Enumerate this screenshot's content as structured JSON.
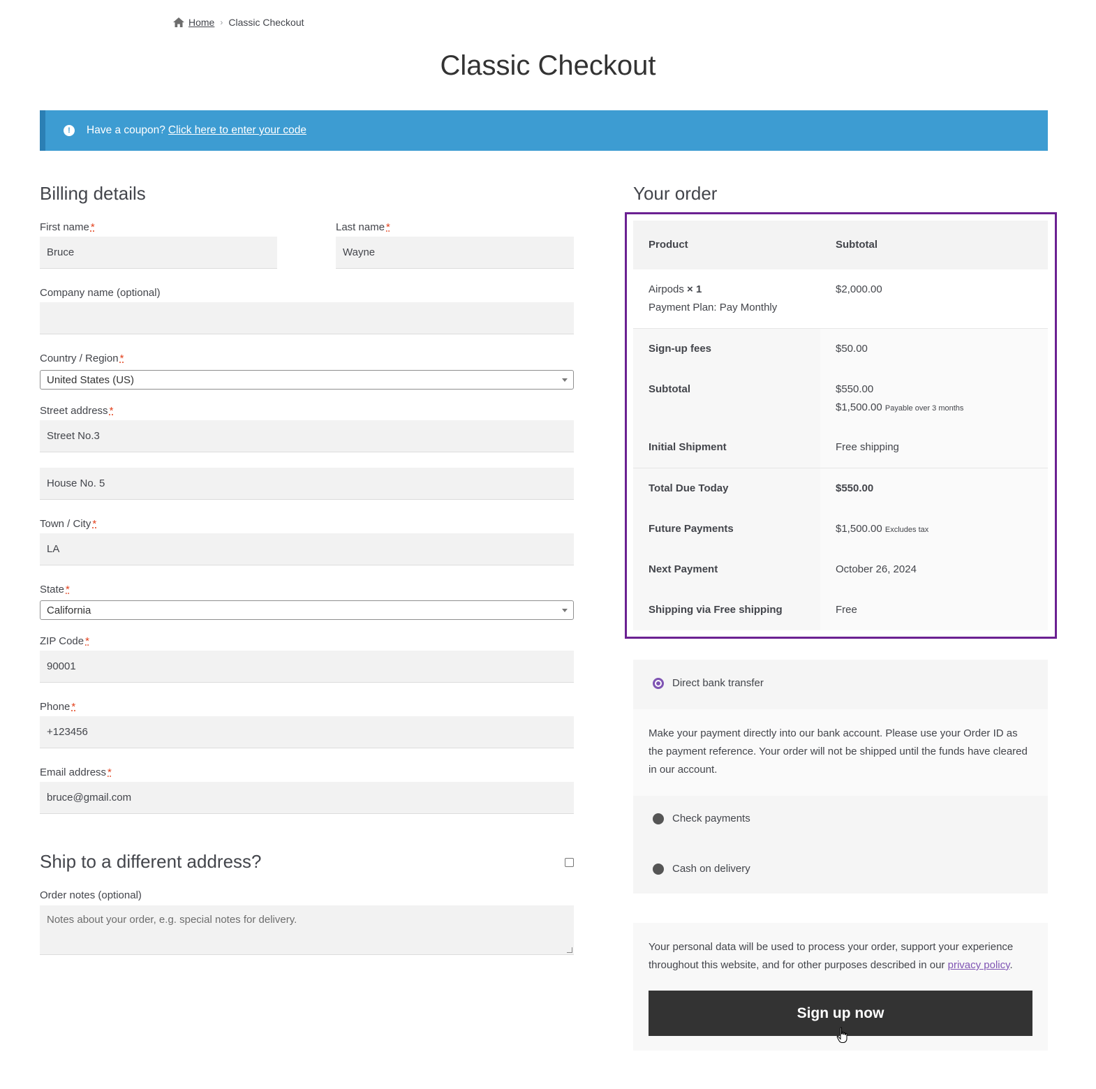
{
  "breadcrumb": {
    "home": "Home",
    "separator": "›",
    "current": "Classic Checkout"
  },
  "page_title": "Classic Checkout",
  "coupon": {
    "text": "Have a coupon?",
    "link": "Click here to enter your code",
    "icon": "info-icon"
  },
  "billing": {
    "heading": "Billing details",
    "required_mark": "*",
    "first_name": {
      "label": "First name",
      "value": "Bruce"
    },
    "last_name": {
      "label": "Last name",
      "value": "Wayne"
    },
    "company": {
      "label": "Company name (optional)",
      "value": ""
    },
    "country": {
      "label": "Country / Region",
      "value": "United States (US)"
    },
    "street": {
      "label": "Street address",
      "line1": "Street No.3",
      "line2": "House No. 5"
    },
    "city": {
      "label": "Town / City",
      "value": "LA"
    },
    "state": {
      "label": "State",
      "value": "California"
    },
    "zip": {
      "label": "ZIP Code",
      "value": "90001"
    },
    "phone": {
      "label": "Phone",
      "value": "+123456"
    },
    "email": {
      "label": "Email address",
      "value": "bruce@gmail.com"
    }
  },
  "ship_different": {
    "heading": "Ship to a different address?",
    "checked": false
  },
  "order_notes": {
    "label": "Order notes (optional)",
    "placeholder": "Notes about your order, e.g. special notes for delivery."
  },
  "order": {
    "heading": "Your order",
    "col_product": "Product",
    "col_subtotal": "Subtotal",
    "item_name": "Airpods",
    "item_qty": "× 1",
    "item_meta": "Payment Plan: Pay Monthly",
    "item_price": "$2,000.00",
    "signup_fees_label": "Sign-up fees",
    "signup_fees_value": "$50.00",
    "subtotal_label": "Subtotal",
    "subtotal_value1": "$550.00",
    "subtotal_value2": "$1,500.00",
    "subtotal_note": "Payable over 3 months",
    "initial_shipment_label": "Initial Shipment",
    "initial_shipment_value": "Free shipping",
    "total_due_label": "Total Due Today",
    "total_due_value": "$550.00",
    "future_label": "Future Payments",
    "future_value": "$1,500.00",
    "future_note": "Excludes tax",
    "next_label": "Next Payment",
    "next_value": "October 26, 2024",
    "shipping_label": "Shipping via Free shipping",
    "shipping_value": "Free"
  },
  "payment": {
    "methods": [
      {
        "label": "Direct bank transfer",
        "selected": true
      },
      {
        "label": "Check payments",
        "selected": false
      },
      {
        "label": "Cash on delivery",
        "selected": false
      }
    ],
    "description": "Make your payment directly into our bank account. Please use your Order ID as the payment reference. Your order will not be shipped until the funds have cleared in our account."
  },
  "privacy": {
    "text": "Your personal data will be used to process your order, support your experience throughout this website, and for other purposes described in our",
    "link": "privacy policy",
    "end": "."
  },
  "submit_label": "Sign up now",
  "colors": {
    "coupon_bg": "#3d9cd2",
    "accent": "#7f54b3",
    "highlight_border": "#6b2192",
    "button_bg": "#333333"
  }
}
